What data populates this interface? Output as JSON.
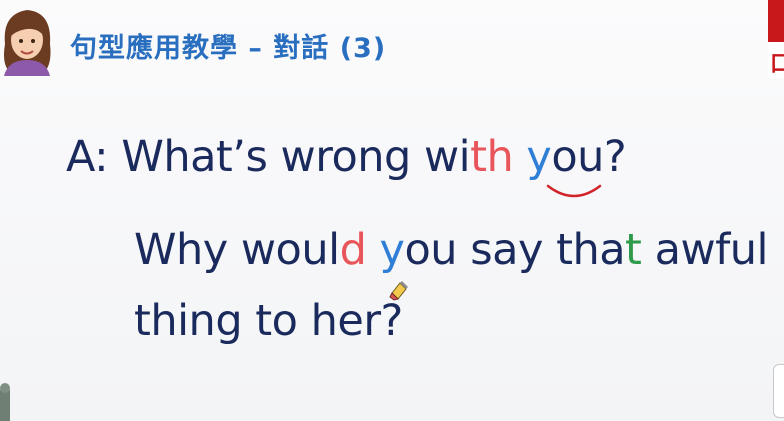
{
  "header": {
    "title": "句型應用教學 – 對話 (3)",
    "corner_glyph": "口"
  },
  "dialogue": {
    "line1": {
      "prefix": "A: What’s wrong wi",
      "hl1": "th",
      "gap": " ",
      "hl2": "y",
      "suffix": "ou?"
    },
    "line2": {
      "prefix": "Why woul",
      "hl1": "d",
      "gap": " ",
      "hl2": "y",
      "mid": "ou say tha",
      "hl3": "t",
      "suffix": " awful"
    },
    "line3": "thing to her?"
  },
  "colors": {
    "title": "#2a6fbf",
    "text": "#1a2a5c",
    "highlight_red": "#e8555b",
    "highlight_blue": "#2f7fd6",
    "highlight_green": "#2f9a4a",
    "corner_red": "#c8181b"
  },
  "icons": {
    "avatar": "teacher-avatar",
    "cursor": "highlighter-cursor-icon",
    "link": "liaison-arc"
  }
}
